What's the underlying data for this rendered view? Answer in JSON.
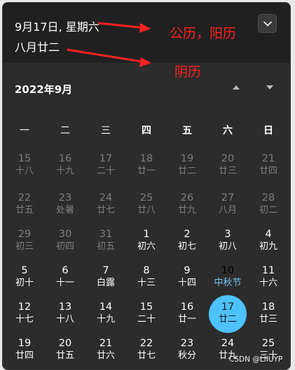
{
  "header": {
    "date_text": "9月17日, 星期六",
    "lunar_text": "八月廿二"
  },
  "annotations": {
    "solar_lunar": "公历，阳历",
    "lunar": "阴历"
  },
  "nav": {
    "month_title": "2022年9月"
  },
  "weekdays": [
    "一",
    "二",
    "三",
    "四",
    "五",
    "六",
    "日"
  ],
  "weeks": [
    [
      {
        "day": "15",
        "sub": "十八",
        "type": "other"
      },
      {
        "day": "16",
        "sub": "十九",
        "type": "other"
      },
      {
        "day": "17",
        "sub": "二十",
        "type": "other"
      },
      {
        "day": "18",
        "sub": "廿一",
        "type": "other"
      },
      {
        "day": "19",
        "sub": "廿二",
        "type": "other"
      },
      {
        "day": "20",
        "sub": "廿三",
        "type": "other"
      },
      {
        "day": "21",
        "sub": "廿四",
        "type": "other"
      }
    ],
    [
      {
        "day": "22",
        "sub": "廿五",
        "type": "other"
      },
      {
        "day": "23",
        "sub": "处暑",
        "type": "other"
      },
      {
        "day": "24",
        "sub": "廿七",
        "type": "other"
      },
      {
        "day": "25",
        "sub": "廿八",
        "type": "other"
      },
      {
        "day": "26",
        "sub": "廿九",
        "type": "other"
      },
      {
        "day": "27",
        "sub": "八月",
        "type": "other"
      },
      {
        "day": "28",
        "sub": "初二",
        "type": "other"
      }
    ],
    [
      {
        "day": "29",
        "sub": "初三",
        "type": "other"
      },
      {
        "day": "30",
        "sub": "初四",
        "type": "other"
      },
      {
        "day": "31",
        "sub": "初五",
        "type": "other"
      },
      {
        "day": "1",
        "sub": "初六",
        "type": "current"
      },
      {
        "day": "2",
        "sub": "初七",
        "type": "current"
      },
      {
        "day": "3",
        "sub": "初八",
        "type": "current"
      },
      {
        "day": "4",
        "sub": "初九",
        "type": "current"
      }
    ],
    [
      {
        "day": "5",
        "sub": "初十",
        "type": "current"
      },
      {
        "day": "6",
        "sub": "十一",
        "type": "current"
      },
      {
        "day": "7",
        "sub": "白露",
        "type": "current"
      },
      {
        "day": "8",
        "sub": "十三",
        "type": "current"
      },
      {
        "day": "9",
        "sub": "十四",
        "type": "current"
      },
      {
        "day": "10",
        "sub": "中秋节",
        "type": "festival"
      },
      {
        "day": "11",
        "sub": "十六",
        "type": "current"
      }
    ],
    [
      {
        "day": "12",
        "sub": "十七",
        "type": "current"
      },
      {
        "day": "13",
        "sub": "十八",
        "type": "current"
      },
      {
        "day": "14",
        "sub": "十九",
        "type": "current"
      },
      {
        "day": "15",
        "sub": "二十",
        "type": "current"
      },
      {
        "day": "16",
        "sub": "廿一",
        "type": "current"
      },
      {
        "day": "17",
        "sub": "廿二",
        "type": "today"
      },
      {
        "day": "18",
        "sub": "廿三",
        "type": "current"
      }
    ],
    [
      {
        "day": "19",
        "sub": "廿四",
        "type": "current"
      },
      {
        "day": "20",
        "sub": "廿五",
        "type": "current"
      },
      {
        "day": "21",
        "sub": "廿六",
        "type": "current"
      },
      {
        "day": "22",
        "sub": "廿七",
        "type": "current"
      },
      {
        "day": "23",
        "sub": "秋分",
        "type": "current"
      },
      {
        "day": "24",
        "sub": "廿九",
        "type": "current"
      },
      {
        "day": "25",
        "sub": "三十",
        "type": "current"
      }
    ]
  ],
  "watermark": "CSDN @LIIUYP",
  "colors": {
    "accent": "#4cc2ff",
    "festival": "#74c6f2",
    "annotation": "#ff2020"
  }
}
